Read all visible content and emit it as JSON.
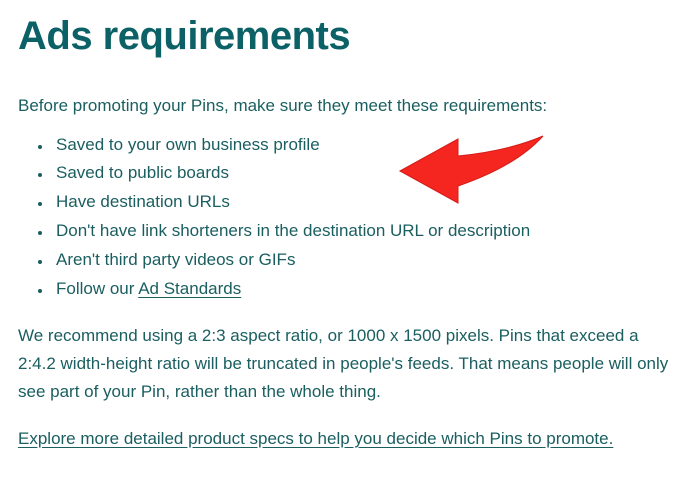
{
  "heading": "Ads requirements",
  "intro": "Before promoting your Pins, make sure they meet these requirements:",
  "requirements": [
    "Saved to your own business profile",
    "Saved to public boards",
    "Have destination URLs",
    "Don't have link shorteners in the destination URL or description",
    "Aren't third party videos or GIFs"
  ],
  "last_item_prefix": "Follow our ",
  "ad_standards_link": "Ad Standards",
  "recommendation": "We recommend using a 2:3 aspect ratio, or 1000 x 1500 pixels. Pins that exceed a 2:4.2 width-height ratio will be truncated in people's feeds. That means people will only see part of your Pin, rather than the whole thing.",
  "explore_link": "Explore more detailed product specs to help you decide which Pins to promote."
}
